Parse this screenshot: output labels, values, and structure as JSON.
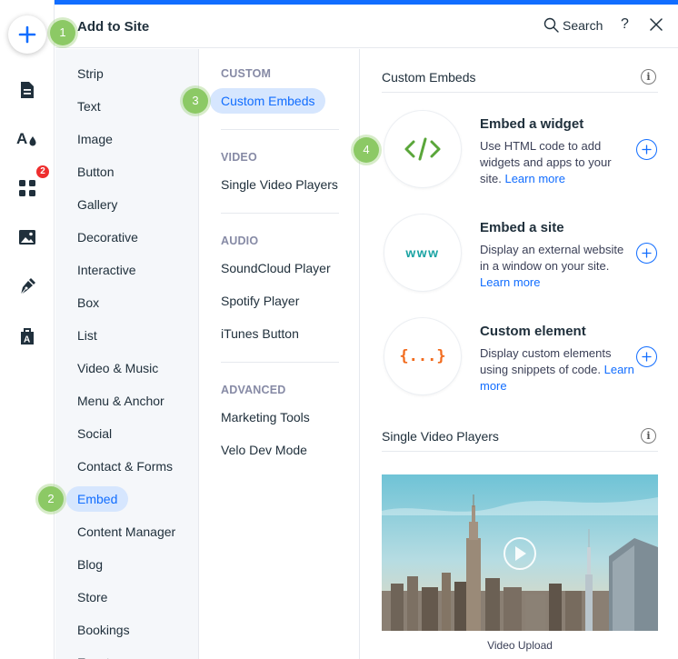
{
  "header": {
    "title": "Add to Site",
    "search_label": "Search",
    "help_label": "?"
  },
  "rail": {
    "badge_count": "2",
    "icons": [
      "plus-icon",
      "pages-icon",
      "theme-icon",
      "apps-icon",
      "media-icon",
      "pen-icon",
      "business-icon"
    ],
    "accent_color": "#116dff"
  },
  "categories": [
    "Strip",
    "Text",
    "Image",
    "Button",
    "Gallery",
    "Decorative",
    "Interactive",
    "Box",
    "List",
    "Video & Music",
    "Menu & Anchor",
    "Social",
    "Contact & Forms",
    "Embed",
    "Content Manager",
    "Blog",
    "Store",
    "Bookings",
    "Events"
  ],
  "active_category": "Embed",
  "sub": {
    "custom_header": "CUSTOM",
    "custom_items": [
      "Custom Embeds"
    ],
    "video_header": "VIDEO",
    "video_items": [
      "Single Video Players"
    ],
    "audio_header": "AUDIO",
    "audio_items": [
      "SoundCloud Player",
      "Spotify Player",
      "iTunes Button"
    ],
    "advanced_header": "ADVANCED",
    "advanced_items": [
      "Marketing Tools",
      "Velo Dev Mode"
    ]
  },
  "content": {
    "section1_title": "Custom Embeds",
    "items": [
      {
        "title": "Embed a widget",
        "desc": "Use HTML code to add widgets and apps to your site.",
        "link": "Learn more",
        "icon_text": "</>",
        "icon_color": "#5aa63a"
      },
      {
        "title": "Embed a site",
        "desc": "Display an external website in a window on your site.",
        "link": "Learn more",
        "icon_text": "www",
        "icon_color": "#1aa3a3"
      },
      {
        "title": "Custom element",
        "desc": "Display custom elements using snippets of code.",
        "link": "Learn more",
        "icon_text": "{...}",
        "icon_color": "#f26b1d"
      }
    ],
    "section2_title": "Single Video Players",
    "video_caption": "Video Upload"
  },
  "steps": [
    "1",
    "2",
    "3",
    "4"
  ],
  "step_color": "#8cc965"
}
